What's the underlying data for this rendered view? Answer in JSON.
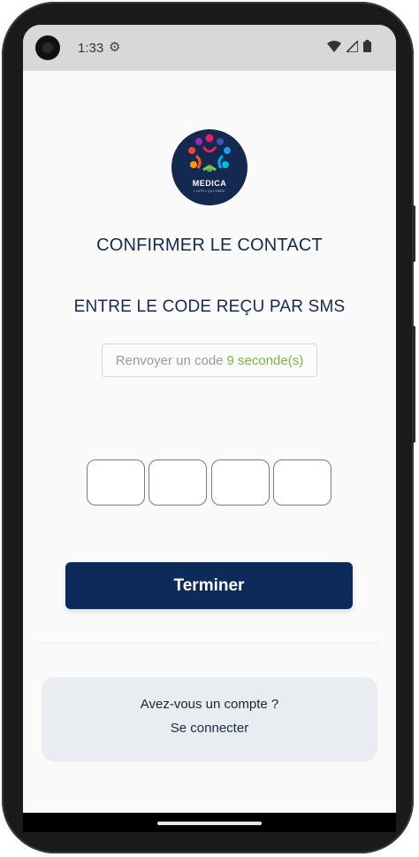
{
  "status": {
    "time": "1:33",
    "settings_icon": "gear-icon"
  },
  "header": {
    "logo_text": "MEDICA",
    "logo_subtext": "L'APPLI QUI VIBRE",
    "title": "CONFIRMER LE CONTACT",
    "subtitle": "ENTRE LE CODE REÇU PAR SMS"
  },
  "resend": {
    "label": "Renvoyer un code",
    "countdown": "9 seconde(s)"
  },
  "otp": {
    "digits": [
      "",
      "",
      "",
      ""
    ]
  },
  "submit": {
    "label": "Terminer"
  },
  "account": {
    "question": "Avez-vous un compte ?",
    "link": "Se connecter"
  },
  "colors": {
    "primary": "#0d2a5a",
    "accent_green": "#7cb342",
    "logo_bg": "#13294f"
  }
}
